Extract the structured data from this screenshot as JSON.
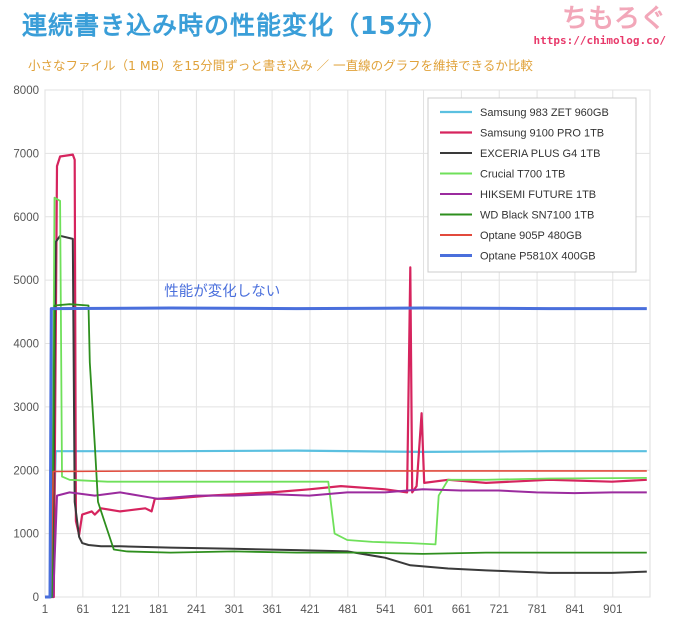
{
  "header": {
    "title": "連続書き込み時の性能変化（15分）",
    "subtitle": "小さなファイル（1 MB）を15分間ずっと書き込み ／ 一直線のグラフを維持できるか比較",
    "brand_name": "ちもろぐ",
    "brand_url": "https://chimolog.co/"
  },
  "chart_data": {
    "type": "line",
    "title": "連続書き込み時の性能変化（15分）",
    "xlabel": "",
    "ylabel": "",
    "xlim": [
      1,
      960
    ],
    "ylim": [
      0,
      8000
    ],
    "grid": true,
    "legend": "top-right",
    "x_ticks": [
      1,
      61,
      121,
      181,
      241,
      301,
      361,
      421,
      481,
      541,
      601,
      661,
      721,
      781,
      841,
      901
    ],
    "y_ticks": [
      0,
      1000,
      2000,
      3000,
      4000,
      5000,
      6000,
      7000,
      8000
    ],
    "annotations": [
      {
        "text": "性能が変化しない",
        "x": 190,
        "y": 4750
      }
    ],
    "series": [
      {
        "name": "Samsung 983 ZET 960GB",
        "color": "#5bc0e0",
        "width": 2.2,
        "points": [
          [
            1,
            0
          ],
          [
            12,
            0
          ],
          [
            18,
            2300
          ],
          [
            200,
            2300
          ],
          [
            400,
            2310
          ],
          [
            600,
            2290
          ],
          [
            800,
            2300
          ],
          [
            955,
            2300
          ]
        ]
      },
      {
        "name": "Samsung 9100 PRO 1TB",
        "color": "#d6245e",
        "width": 2.2,
        "points": [
          [
            1,
            0
          ],
          [
            15,
            0
          ],
          [
            20,
            6800
          ],
          [
            25,
            6950
          ],
          [
            45,
            6980
          ],
          [
            48,
            6900
          ],
          [
            50,
            1200
          ],
          [
            55,
            980
          ],
          [
            60,
            1300
          ],
          [
            75,
            1350
          ],
          [
            80,
            1300
          ],
          [
            90,
            1400
          ],
          [
            120,
            1350
          ],
          [
            160,
            1400
          ],
          [
            170,
            1350
          ],
          [
            175,
            1550
          ],
          [
            200,
            1550
          ],
          [
            260,
            1600
          ],
          [
            300,
            1620
          ],
          [
            360,
            1650
          ],
          [
            420,
            1700
          ],
          [
            470,
            1750
          ],
          [
            540,
            1700
          ],
          [
            575,
            1650
          ],
          [
            580,
            5200
          ],
          [
            583,
            1650
          ],
          [
            590,
            1750
          ],
          [
            598,
            2900
          ],
          [
            602,
            1800
          ],
          [
            640,
            1850
          ],
          [
            700,
            1800
          ],
          [
            800,
            1850
          ],
          [
            900,
            1820
          ],
          [
            955,
            1850
          ]
        ]
      },
      {
        "name": "EXCERIA PLUS G4 1TB",
        "color": "#3a3a3a",
        "width": 2.0,
        "points": [
          [
            1,
            0
          ],
          [
            13,
            0
          ],
          [
            18,
            5600
          ],
          [
            25,
            5700
          ],
          [
            45,
            5650
          ],
          [
            48,
            1500
          ],
          [
            55,
            950
          ],
          [
            60,
            850
          ],
          [
            70,
            820
          ],
          [
            90,
            800
          ],
          [
            120,
            800
          ],
          [
            200,
            780
          ],
          [
            300,
            760
          ],
          [
            400,
            740
          ],
          [
            480,
            720
          ],
          [
            540,
            620
          ],
          [
            580,
            500
          ],
          [
            640,
            450
          ],
          [
            700,
            420
          ],
          [
            800,
            380
          ],
          [
            900,
            380
          ],
          [
            955,
            400
          ]
        ]
      },
      {
        "name": "Crucial T700 1TB",
        "color": "#6fe05a",
        "width": 1.8,
        "points": [
          [
            1,
            0
          ],
          [
            12,
            0
          ],
          [
            16,
            6300
          ],
          [
            25,
            6250
          ],
          [
            28,
            1900
          ],
          [
            40,
            1850
          ],
          [
            100,
            1820
          ],
          [
            200,
            1820
          ],
          [
            300,
            1820
          ],
          [
            450,
            1820
          ],
          [
            460,
            1000
          ],
          [
            480,
            900
          ],
          [
            520,
            870
          ],
          [
            580,
            850
          ],
          [
            620,
            830
          ],
          [
            625,
            1600
          ],
          [
            640,
            1850
          ],
          [
            700,
            1850
          ],
          [
            800,
            1870
          ],
          [
            955,
            1880
          ]
        ]
      },
      {
        "name": "HIKSEMI FUTURE 1TB",
        "color": "#9b2b9e",
        "width": 2.0,
        "points": [
          [
            1,
            0
          ],
          [
            14,
            0
          ],
          [
            20,
            1600
          ],
          [
            40,
            1650
          ],
          [
            80,
            1600
          ],
          [
            120,
            1650
          ],
          [
            180,
            1550
          ],
          [
            240,
            1600
          ],
          [
            300,
            1600
          ],
          [
            360,
            1620
          ],
          [
            420,
            1600
          ],
          [
            480,
            1650
          ],
          [
            540,
            1650
          ],
          [
            600,
            1700
          ],
          [
            660,
            1680
          ],
          [
            720,
            1680
          ],
          [
            780,
            1650
          ],
          [
            840,
            1640
          ],
          [
            900,
            1650
          ],
          [
            955,
            1650
          ]
        ]
      },
      {
        "name": "WD Black SN7100 1TB",
        "color": "#2e8f1e",
        "width": 1.8,
        "points": [
          [
            1,
            0
          ],
          [
            12,
            0
          ],
          [
            16,
            4600
          ],
          [
            40,
            4620
          ],
          [
            70,
            4600
          ],
          [
            72,
            3700
          ],
          [
            80,
            2400
          ],
          [
            85,
            1500
          ],
          [
            95,
            1200
          ],
          [
            110,
            750
          ],
          [
            130,
            720
          ],
          [
            200,
            700
          ],
          [
            300,
            720
          ],
          [
            400,
            700
          ],
          [
            500,
            700
          ],
          [
            600,
            680
          ],
          [
            700,
            700
          ],
          [
            800,
            700
          ],
          [
            955,
            700
          ]
        ]
      },
      {
        "name": "Optane 905P 480GB",
        "color": "#e24a3c",
        "width": 1.6,
        "points": [
          [
            1,
            0
          ],
          [
            10,
            0
          ],
          [
            14,
            1980
          ],
          [
            200,
            1990
          ],
          [
            400,
            1990
          ],
          [
            600,
            1990
          ],
          [
            800,
            1990
          ],
          [
            955,
            1990
          ]
        ]
      },
      {
        "name": "Optane P5810X 400GB",
        "color": "#4a6fdc",
        "width": 3.0,
        "points": [
          [
            1,
            0
          ],
          [
            9,
            0
          ],
          [
            11,
            4550
          ],
          [
            200,
            4560
          ],
          [
            400,
            4550
          ],
          [
            600,
            4560
          ],
          [
            800,
            4550
          ],
          [
            955,
            4550
          ]
        ]
      }
    ]
  }
}
